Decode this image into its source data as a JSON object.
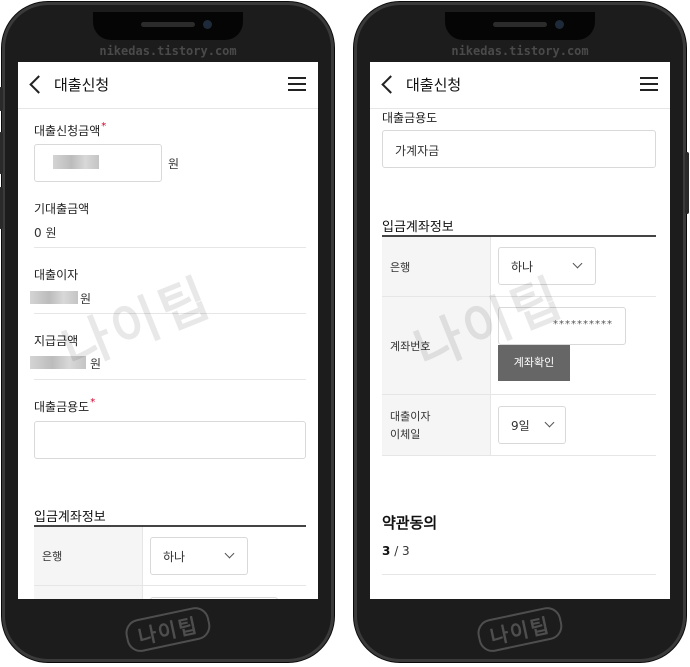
{
  "watermark_top": "nikedas.tistory.com",
  "watermark_big": "나이팁",
  "watermark_logo": "나이팁",
  "left": {
    "app_title": "대출신청",
    "loan_amount_label": "대출신청금액",
    "loan_amount_unit": "원",
    "expected_amount_label": "기대출금액",
    "expected_amount_value": "0 원",
    "interest_label": "대출이자",
    "interest_unit": "원",
    "payment_label": "지급금액",
    "payment_unit": "원",
    "purpose_label": "대출금용도",
    "purpose_value": "",
    "deposit_section_title": "입금계좌정보",
    "bank_label": "은행",
    "bank_value": "하나"
  },
  "right": {
    "app_title": "대출신청",
    "purpose_label": "대출금용도",
    "purpose_value": "가계자금",
    "deposit_section_title": "입금계좌정보",
    "bank_label": "은행",
    "bank_value": "하나",
    "account_label": "계좌번호",
    "account_value": "**********",
    "verify_button": "계좌확인",
    "transfer_label_1": "대출이자",
    "transfer_label_2": "이체일",
    "transfer_day": "9일",
    "terms_title": "약관동의",
    "terms_current": "3",
    "terms_total": "/ 3"
  }
}
